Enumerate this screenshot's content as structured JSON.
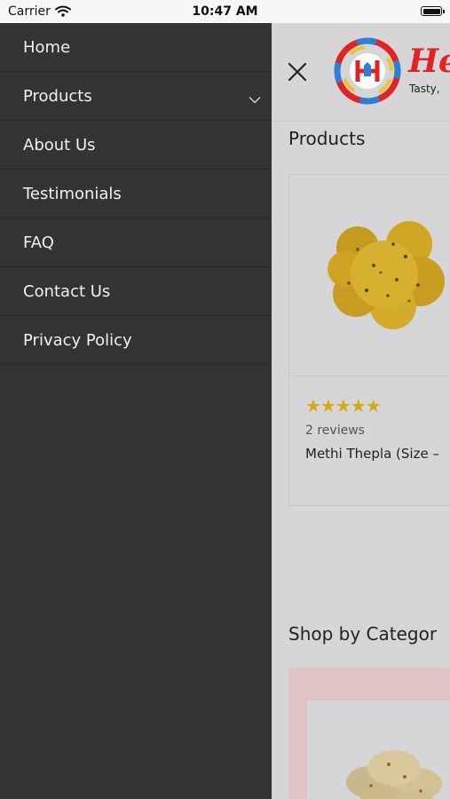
{
  "status_bar": {
    "carrier": "Carrier",
    "time": "10:47 AM"
  },
  "menu": {
    "items": [
      {
        "label": "Home"
      },
      {
        "label": "Products",
        "has_submenu": true
      },
      {
        "label": "About Us"
      },
      {
        "label": "Testimonials"
      },
      {
        "label": "FAQ"
      },
      {
        "label": "Contact Us"
      },
      {
        "label": "Privacy Policy"
      }
    ]
  },
  "header": {
    "logo_text": "He",
    "tagline": "Tasty,"
  },
  "products": {
    "title": "Products",
    "card": {
      "rating": 5,
      "stars": "★★★★★",
      "reviews": "2 reviews",
      "name": "Methi Thepla (Size –"
    }
  },
  "categories": {
    "title": "Shop by Categor"
  },
  "colors": {
    "drawer_bg": "#333333",
    "star": "#d9a80f",
    "brand_red": "#e02424"
  }
}
